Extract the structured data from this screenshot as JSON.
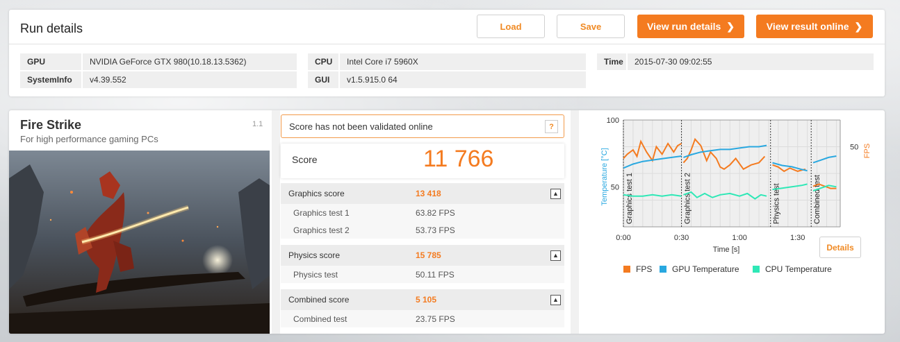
{
  "run_details": {
    "title": "Run details",
    "buttons": {
      "load": "Load",
      "save": "Save",
      "view_run": "View run details",
      "view_online": "View result online"
    },
    "info": {
      "gpu_label": "GPU",
      "gpu_value": "NVIDIA GeForce GTX 980(10.18.13.5362)",
      "sysinfo_label": "SystemInfo",
      "sysinfo_value": "v4.39.552",
      "cpu_label": "CPU",
      "cpu_value": "Intel Core i7 5960X",
      "gui_label": "GUI",
      "gui_value": "v1.5.915.0 64",
      "time_label": "Time",
      "time_value": "2015-07-30 09:02:55"
    }
  },
  "benchmark": {
    "name": "Fire Strike",
    "subtitle": "For high performance gaming PCs",
    "version": "1.1",
    "validation_notice": "Score has not been validated online",
    "help_glyph": "?",
    "score_label": "Score",
    "score_value": "11 766",
    "graphics": {
      "label": "Graphics score",
      "value": "13 418",
      "tests": [
        {
          "label": "Graphics test 1",
          "value": "63.82 FPS"
        },
        {
          "label": "Graphics test 2",
          "value": "53.73 FPS"
        }
      ]
    },
    "physics": {
      "label": "Physics score",
      "value": "15 785",
      "tests": [
        {
          "label": "Physics test",
          "value": "50.11 FPS"
        }
      ]
    },
    "combined": {
      "label": "Combined score",
      "value": "5 105",
      "tests": [
        {
          "label": "Combined test",
          "value": "23.75 FPS"
        }
      ]
    },
    "details_button": "Details",
    "toggle_glyph": "▲"
  },
  "colors": {
    "accent": "#f47b20",
    "fps": "#f47b20",
    "gpu_temp": "#29a8e0",
    "cpu_temp": "#2ee8b6"
  },
  "chart_data": {
    "type": "line",
    "x_unit": "seconds",
    "xlabel": "Time [s]",
    "ylabel_left": "Temperature [°C]",
    "ylabel_right": "FPS",
    "x_ticks": [
      "0:00",
      "0:30",
      "1:00",
      "1:30"
    ],
    "y_left_ticks": [
      "100",
      "50"
    ],
    "y_right_ticks": [
      "50"
    ],
    "xlim": [
      0,
      112
    ],
    "ylim_left": [
      20,
      100
    ],
    "ylim_right": [
      0,
      100
    ],
    "sections": [
      {
        "label": "Graphics test 1",
        "start": 0,
        "end": 30
      },
      {
        "label": "Graphics test 2",
        "start": 30,
        "end": 76
      },
      {
        "label": "Physics test",
        "start": 76,
        "end": 97
      },
      {
        "label": "Combined test",
        "start": 97,
        "end": 112
      }
    ],
    "series": [
      {
        "name": "FPS",
        "axis": "right",
        "segments": [
          [
            [
              0,
              64
            ],
            [
              2,
              68
            ],
            [
              5,
              72
            ],
            [
              7,
              66
            ],
            [
              9,
              80
            ],
            [
              12,
              70
            ],
            [
              15,
              62
            ],
            [
              17,
              75
            ],
            [
              20,
              68
            ],
            [
              23,
              78
            ],
            [
              26,
              70
            ],
            [
              28,
              76
            ],
            [
              30,
              78
            ]
          ],
          [
            [
              31,
              60
            ],
            [
              33,
              64
            ],
            [
              35,
              72
            ],
            [
              37,
              82
            ],
            [
              40,
              76
            ],
            [
              43,
              62
            ],
            [
              45,
              70
            ],
            [
              48,
              64
            ],
            [
              50,
              56
            ],
            [
              52,
              54
            ],
            [
              55,
              58
            ],
            [
              58,
              64
            ],
            [
              62,
              54
            ],
            [
              66,
              58
            ],
            [
              70,
              60
            ],
            [
              73,
              66
            ]
          ],
          [
            [
              77,
              58
            ],
            [
              80,
              56
            ],
            [
              83,
              52
            ],
            [
              86,
              55
            ],
            [
              90,
              52
            ],
            [
              94,
              54
            ]
          ],
          [
            [
              98,
              38
            ],
            [
              101,
              40
            ],
            [
              104,
              38
            ],
            [
              107,
              36
            ],
            [
              110,
              36
            ]
          ]
        ]
      },
      {
        "name": "GPU Temperature",
        "axis": "left",
        "segments": [
          [
            [
              0,
              64
            ],
            [
              5,
              67
            ],
            [
              10,
              69
            ],
            [
              15,
              70
            ],
            [
              20,
              71
            ],
            [
              25,
              72
            ],
            [
              30,
              73
            ]
          ],
          [
            [
              31,
              72
            ],
            [
              35,
              74
            ],
            [
              40,
              76
            ],
            [
              45,
              77
            ],
            [
              50,
              78
            ],
            [
              55,
              78
            ],
            [
              60,
              79
            ],
            [
              65,
              80
            ],
            [
              70,
              80
            ],
            [
              74,
              81
            ]
          ],
          [
            [
              77,
              68
            ],
            [
              82,
              66
            ],
            [
              87,
              65
            ],
            [
              92,
              63
            ],
            [
              95,
              62
            ]
          ],
          [
            [
              98,
              68
            ],
            [
              102,
              70
            ],
            [
              106,
              72
            ],
            [
              110,
              73
            ]
          ]
        ]
      },
      {
        "name": "CPU Temperature",
        "axis": "left",
        "segments": [
          [
            [
              0,
              44
            ],
            [
              5,
              43
            ],
            [
              10,
              43
            ],
            [
              15,
              44
            ],
            [
              20,
              43
            ],
            [
              25,
              44
            ],
            [
              30,
              43
            ]
          ],
          [
            [
              31,
              44
            ],
            [
              35,
              46
            ],
            [
              38,
              42
            ],
            [
              42,
              45
            ],
            [
              46,
              42
            ],
            [
              50,
              44
            ],
            [
              55,
              45
            ],
            [
              60,
              43
            ],
            [
              64,
              45
            ],
            [
              68,
              41
            ],
            [
              71,
              44
            ],
            [
              74,
              43
            ]
          ],
          [
            [
              77,
              48
            ],
            [
              82,
              49
            ],
            [
              87,
              50
            ],
            [
              92,
              51
            ],
            [
              95,
              52
            ]
          ],
          [
            [
              98,
              47
            ],
            [
              102,
              49
            ],
            [
              106,
              51
            ],
            [
              110,
              50
            ]
          ]
        ]
      }
    ],
    "legend": [
      "FPS",
      "GPU Temperature",
      "CPU Temperature"
    ],
    "grid": true
  }
}
